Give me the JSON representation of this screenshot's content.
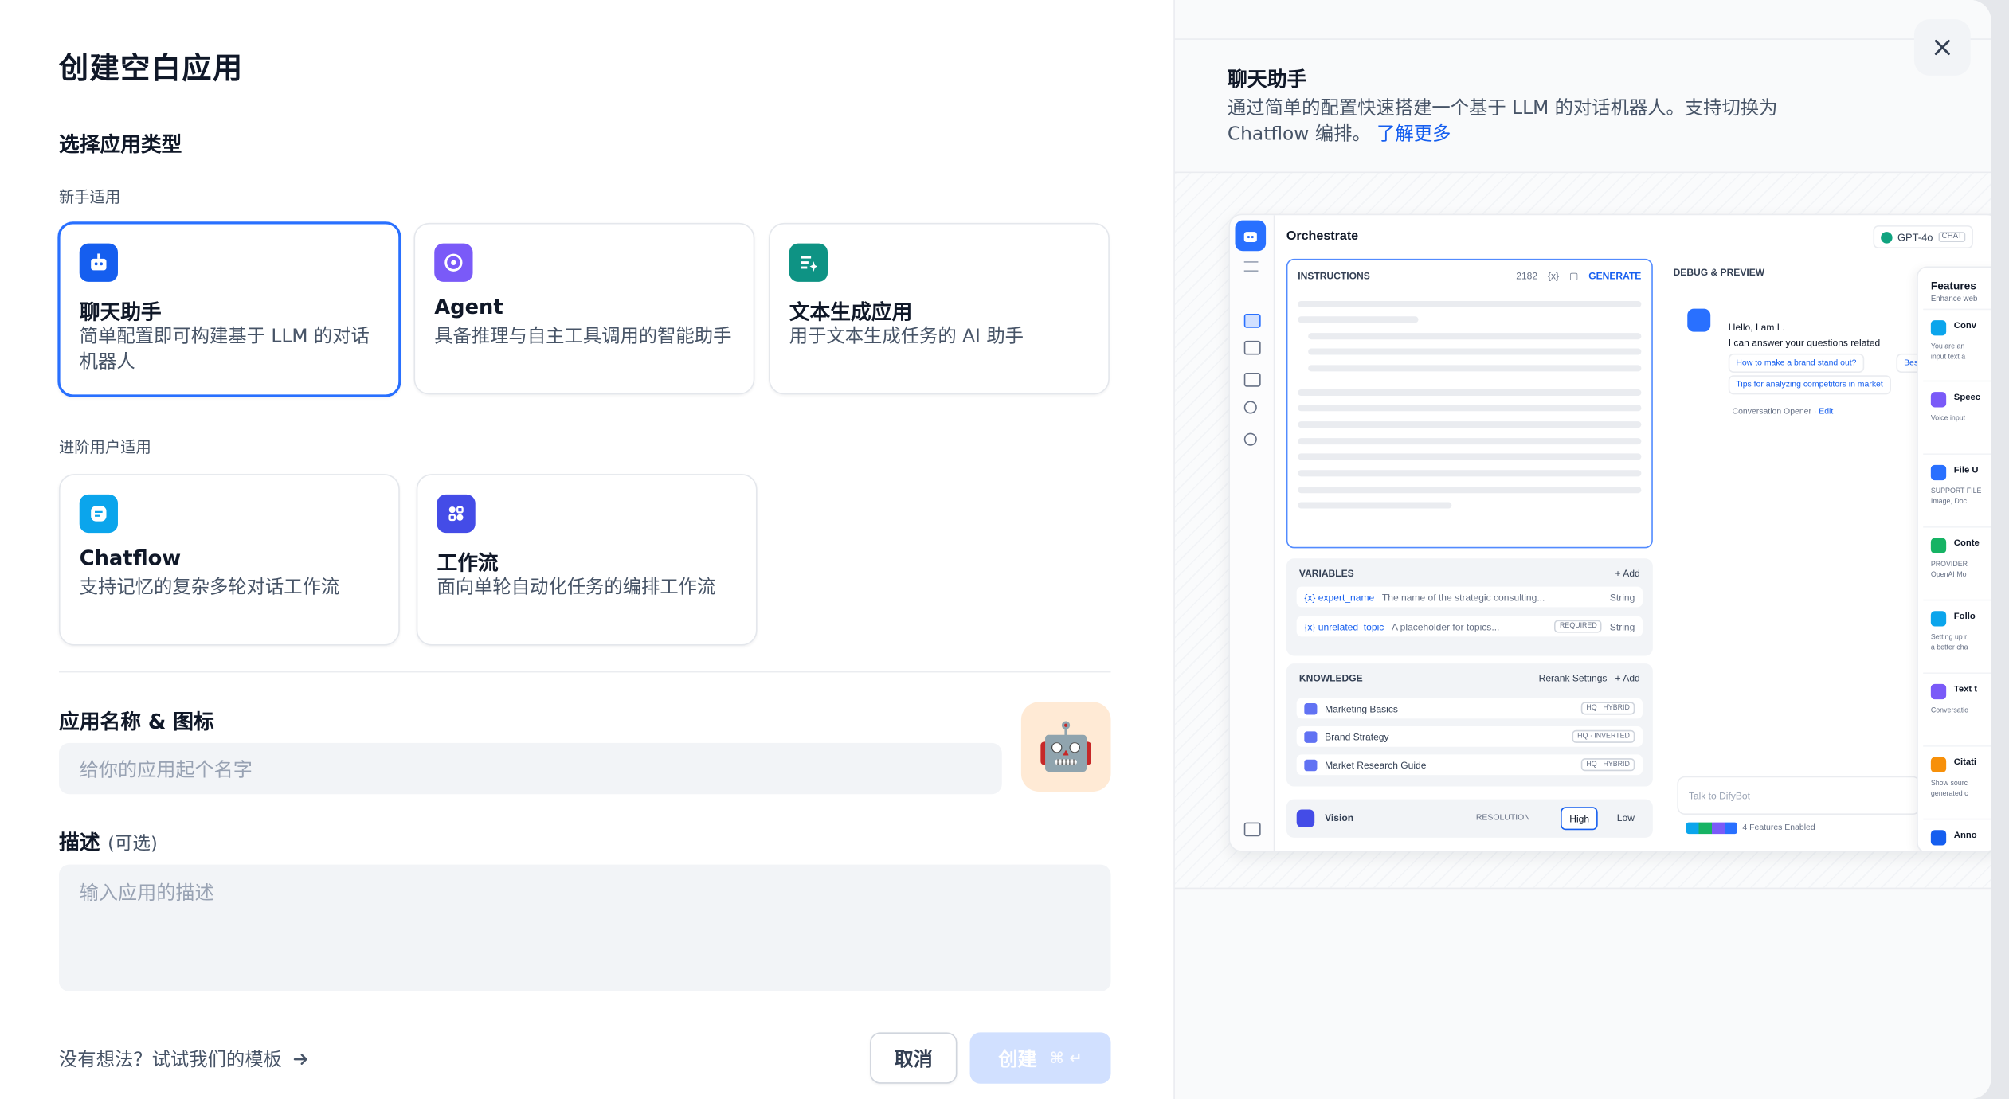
{
  "dialog": {
    "title": "创建空白应用",
    "section_type": "选择应用类型",
    "group_beginner": "新手适用",
    "group_advanced": "进阶用户适用",
    "app_types": [
      {
        "name": "聊天助手",
        "desc": "简单配置即可构建基于 LLM 的对话机器人",
        "color": "#155eef",
        "selected": true
      },
      {
        "name": "Agent",
        "desc": "具备推理与自主工具调用的智能助手",
        "color": "#7a5af8"
      },
      {
        "name": "文本生成应用",
        "desc": "用于文本生成任务的 AI 助手",
        "color": "#0e9384"
      },
      {
        "name": "Chatflow",
        "desc": "支持记忆的复杂多轮对话工作流",
        "color": "#0ba5ec"
      },
      {
        "name": "工作流",
        "desc": "面向单轮自动化任务的编排工作流",
        "color": "#444ce7"
      }
    ],
    "name_label": "应用名称 & 图标",
    "name_placeholder": "给你的应用起个名字",
    "icon_emoji": "🤖",
    "desc_label": "描述",
    "desc_optional": "(可选)",
    "desc_placeholder": "输入应用的描述",
    "template_link": "没有想法？试试我们的模板",
    "cancel_label": "取消",
    "create_label": "创建",
    "create_kbd": "⌘ ↵"
  },
  "preview": {
    "title": "聊天助手",
    "desc": "通过简单的配置快速搭建一个基于 LLM 的对话机器人。支持切换为 Chatflow 编排。",
    "learn_more": "了解更多",
    "mock": {
      "header": "Orchestrate",
      "model": "GPT-4o",
      "model_tag": "CHAT",
      "instructions": "INSTRUCTIONS",
      "instr_count": "2182",
      "instr_var": "{x}",
      "generate": "GENERATE",
      "variables": "VARIABLES",
      "add": "+ Add",
      "var_rows": [
        {
          "name": "{x} expert_name",
          "desc": "The name of the strategic consulting...",
          "type": "String",
          "req": ""
        },
        {
          "name": "{x} unrelated_topic",
          "desc": "A placeholder for topics...",
          "type": "String",
          "req": "REQUIRED"
        }
      ],
      "knowledge": "KNOWLEDGE",
      "rerank": "Rerank Settings",
      "kb_rows": [
        {
          "name": "Marketing Basics",
          "tag": "HQ · HYBRID"
        },
        {
          "name": "Brand Strategy",
          "tag": "HQ · INVERTED"
        },
        {
          "name": "Market Research Guide",
          "tag": "HQ · HYBRID"
        }
      ],
      "vision": "Vision",
      "resolution": "RESOLUTION",
      "high": "High",
      "low": "Low",
      "debug": "DEBUG & PREVIEW",
      "greet1": "Hello, I am L.",
      "greet2": "I can answer your questions related",
      "sugg1": "How to make a brand stand out?",
      "sugg1b": "Bes",
      "sugg2": "Tips for analyzing competitors in market",
      "opener": "Conversation Opener",
      "edit": "Edit",
      "talk": "Talk to DifyBot",
      "features_enabled": "4 Features Enabled",
      "features_title": "Features",
      "features_sub": "Enhance web",
      "features": [
        {
          "name": "Conv",
          "desc": "You are an\ninput text a",
          "color": "#0ba5ec"
        },
        {
          "name": "Speec",
          "desc": "Voice input",
          "color": "#7a5af8"
        },
        {
          "name": "File U",
          "desc": "SUPPORT FILE\nImage, Doc",
          "color": "#2970ff"
        },
        {
          "name": "Conte",
          "desc": "PROVIDER\nOpenAI Mo",
          "color": "#16b364"
        },
        {
          "name": "Follo",
          "desc": "Setting up r\na better cha",
          "color": "#0ba5ec"
        },
        {
          "name": "Text t",
          "desc": "Conversatio",
          "color": "#7a5af8"
        },
        {
          "name": "Citati",
          "desc": "Show sourc\ngenerated c",
          "color": "#f79009"
        },
        {
          "name": "Anno",
          "desc": "",
          "color": "#155eef"
        }
      ]
    }
  }
}
